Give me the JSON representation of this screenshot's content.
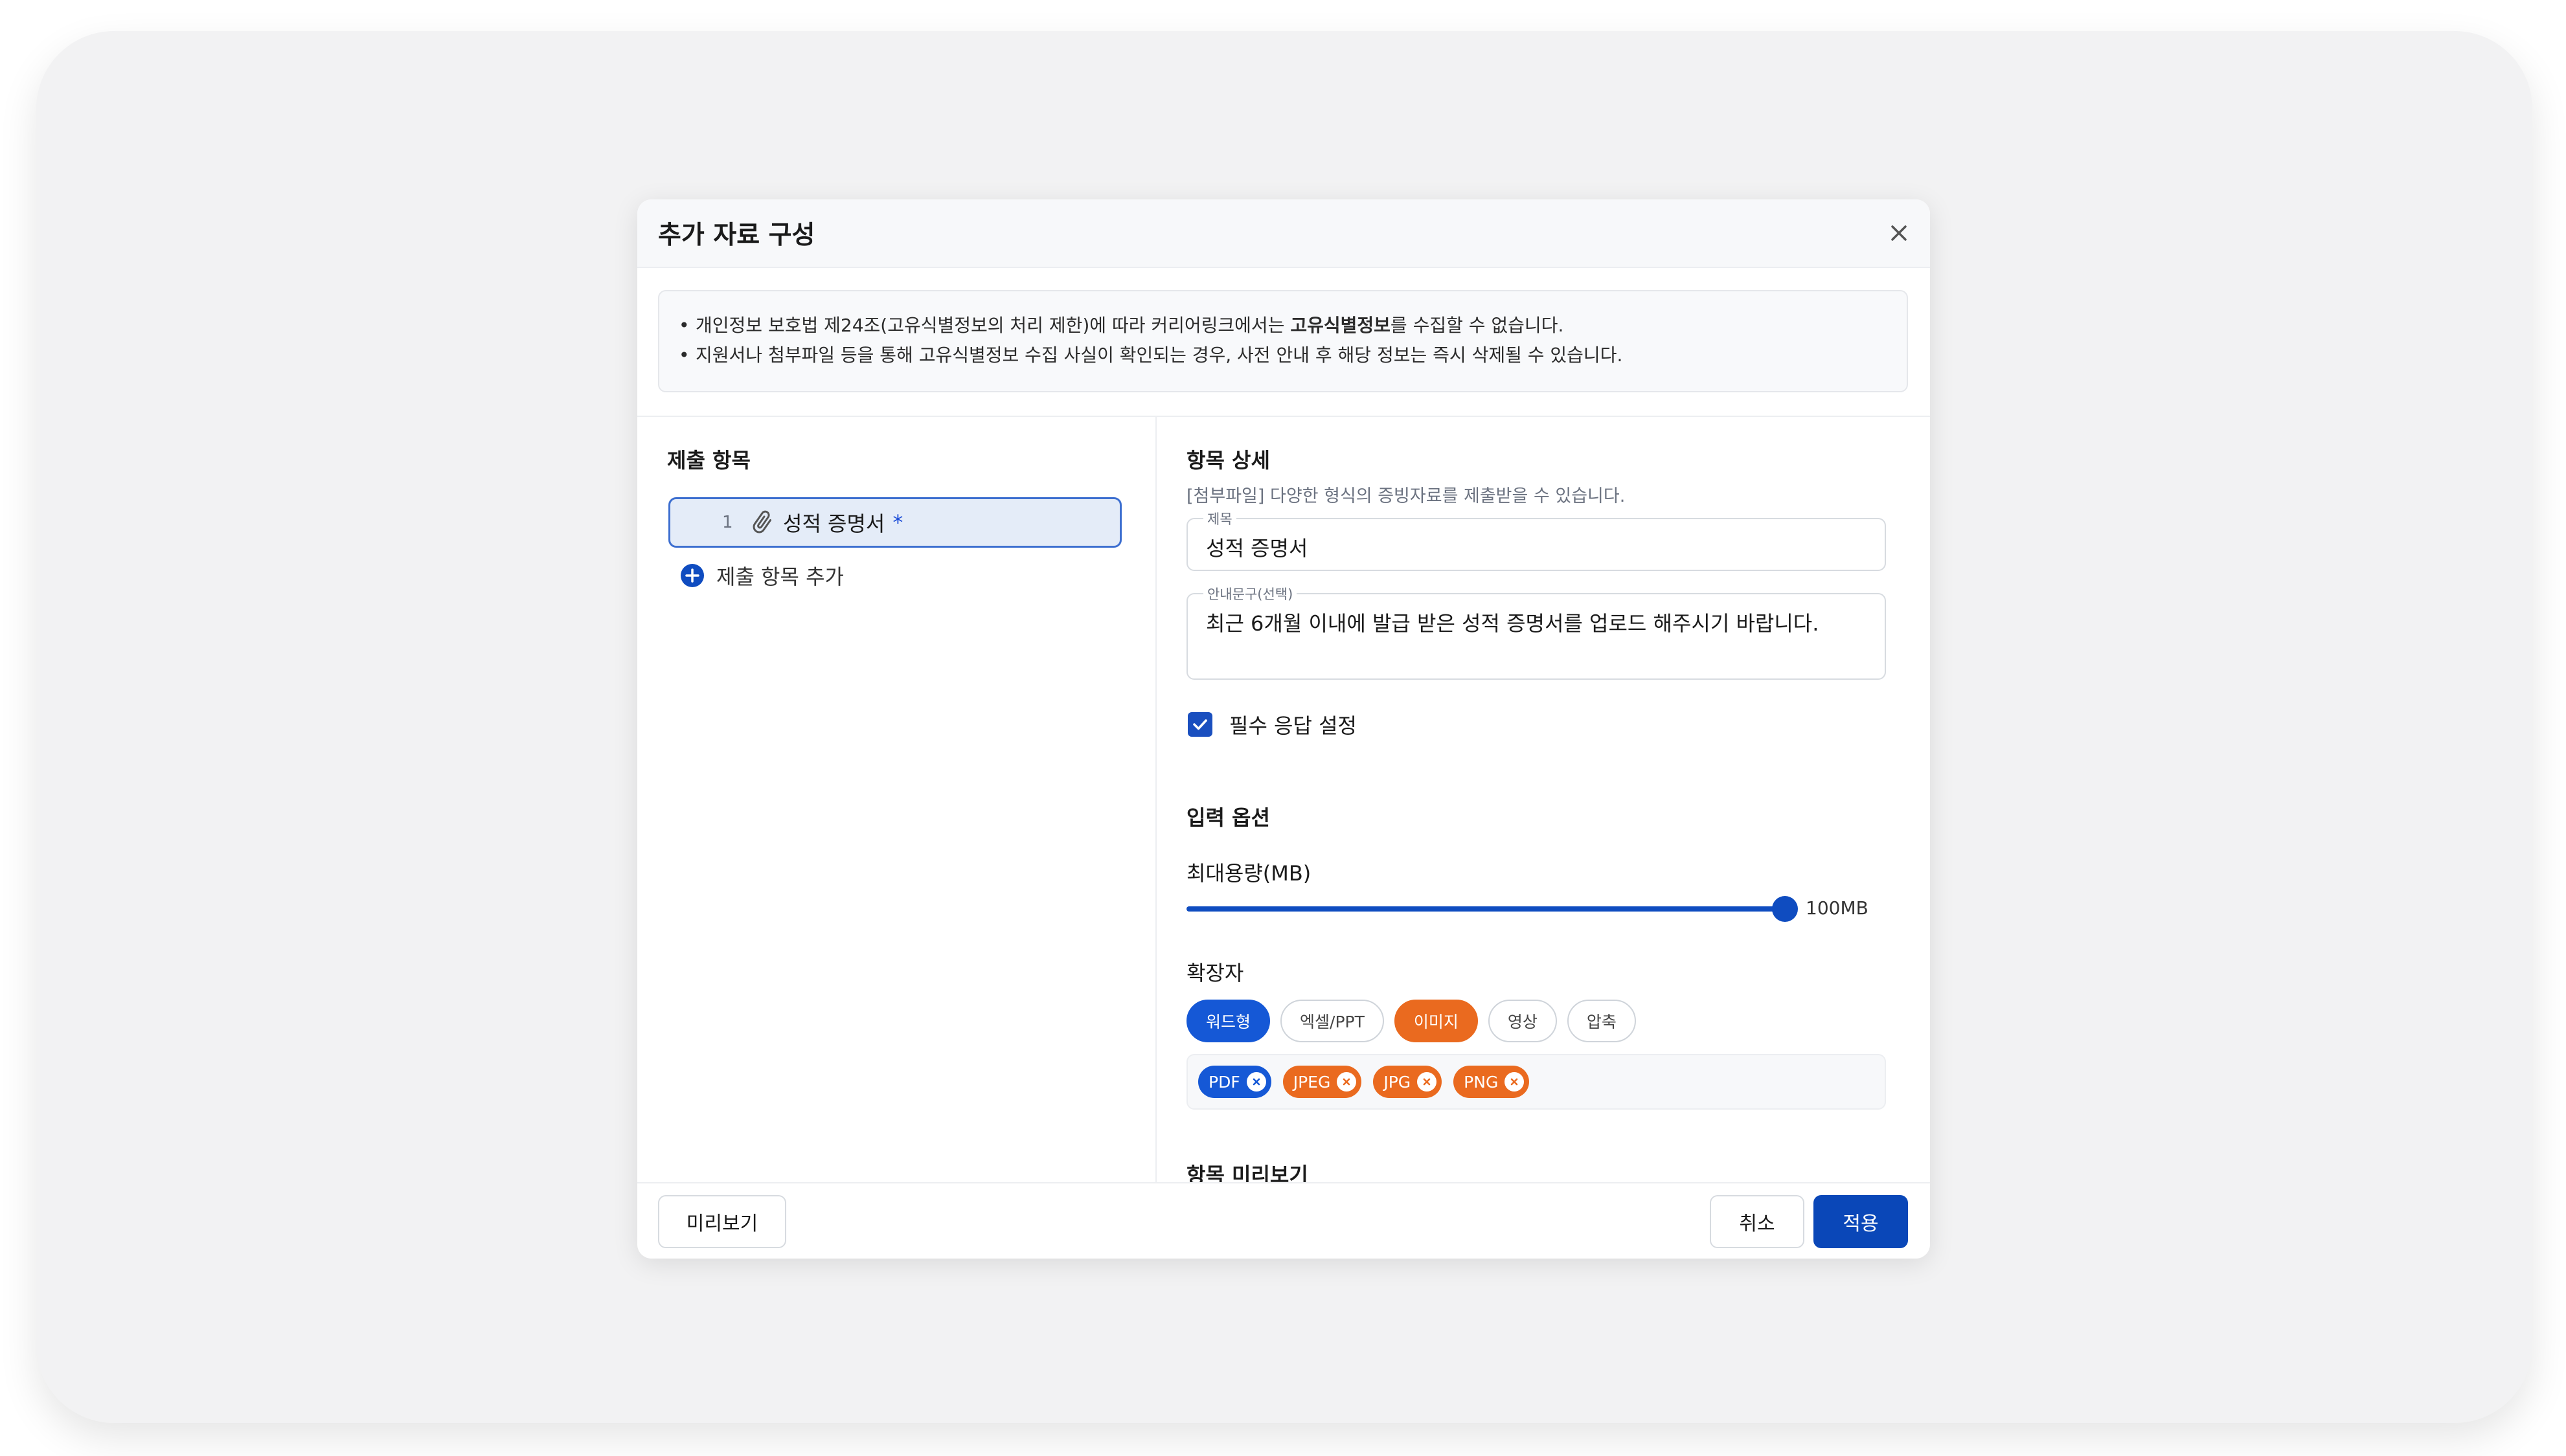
{
  "dialog": {
    "title": "추가 자료 구성",
    "notice": {
      "line1_pre": "개인정보 보호법 제24조(고유식별정보의 처리 제한)에 따라 커리어링크에서는 ",
      "line1_bold": "고유식별정보",
      "line1_post": "를 수집할 수 없습니다.",
      "line2": "지원서나 첨부파일 등을 통해 고유식별정보 수집 사실이 확인되는 경우, 사전 안내 후 해당 정보는 즉시 삭제될 수 있습니다."
    }
  },
  "left": {
    "title": "제출 항목",
    "items": [
      {
        "number": "1",
        "name": "성적 증명서",
        "required_mark": "*",
        "icon": "paperclip-icon"
      }
    ],
    "add_label": "제출 항목 추가"
  },
  "detail": {
    "title": "항목 상세",
    "hint": "[첨부파일] 다양한 형식의 증빙자료를 제출받을 수 있습니다.",
    "title_field": {
      "label": "제목",
      "value": "성적 증명서"
    },
    "guide_field": {
      "label": "안내문구(선택)",
      "value": "최근 6개월 이내에 발급 받은 성적 증명서를 업로드 해주시기 바랍니다."
    },
    "required": {
      "label": "필수 응답 설정",
      "checked": true
    }
  },
  "options": {
    "title": "입력 옵션",
    "size_label": "최대용량(MB)",
    "size_value": "100MB",
    "size_fraction": 1.0,
    "ext_label": "확장자",
    "chips": [
      {
        "label": "워드형",
        "state": "selected-blue"
      },
      {
        "label": "엑셀/PPT",
        "state": "unselected"
      },
      {
        "label": "이미지",
        "state": "selected-orange"
      },
      {
        "label": "영상",
        "state": "unselected"
      },
      {
        "label": "압축",
        "state": "unselected"
      }
    ],
    "tags": [
      {
        "label": "PDF",
        "color": "#1558d6"
      },
      {
        "label": "JPEG",
        "color": "#ea6a1f"
      },
      {
        "label": "JPG",
        "color": "#ea6a1f"
      },
      {
        "label": "PNG",
        "color": "#ea6a1f"
      }
    ]
  },
  "preview": {
    "title": "항목 미리보기"
  },
  "footer": {
    "preview_button": "미리보기",
    "cancel_button": "취소",
    "apply_button": "적용"
  },
  "colors": {
    "primary": "#0a47b8",
    "accent_orange": "#ea6a1f",
    "selected_bg": "#e4ecf8"
  }
}
